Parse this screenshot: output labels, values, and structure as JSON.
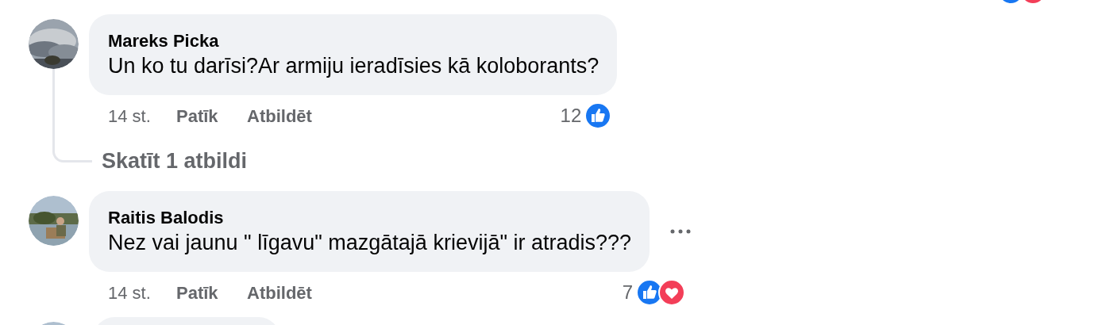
{
  "top_reactions": [
    {
      "kind": "like"
    },
    {
      "kind": "love"
    }
  ],
  "comments": [
    {
      "author": "Mareks Picka",
      "text": "Un ko tu darīsi?Ar armiju ieradīsies kā koloborants?",
      "avatar": {
        "kind": "picture"
      },
      "time": "14 st.",
      "like_label": "Patīk",
      "reply_label": "Atbildēt",
      "reaction_count": "12",
      "reactions": [
        {
          "kind": "like"
        }
      ],
      "menu": false,
      "replies_link": "Skatīt 1 atbildi"
    },
    {
      "author": "Raitis Balodis",
      "text": "Nez vai jaunu \" līgavu\" mazgātajā krievijā\" ir atradis???",
      "avatar": {
        "kind": "picture"
      },
      "time": "14 st.",
      "like_label": "Patīk",
      "reply_label": "Atbildēt",
      "reaction_count": "7",
      "reactions": [
        {
          "kind": "like"
        },
        {
          "kind": "love"
        }
      ],
      "menu": true
    }
  ],
  "next_comment": {
    "avatar": {
      "kind": "picture"
    }
  }
}
